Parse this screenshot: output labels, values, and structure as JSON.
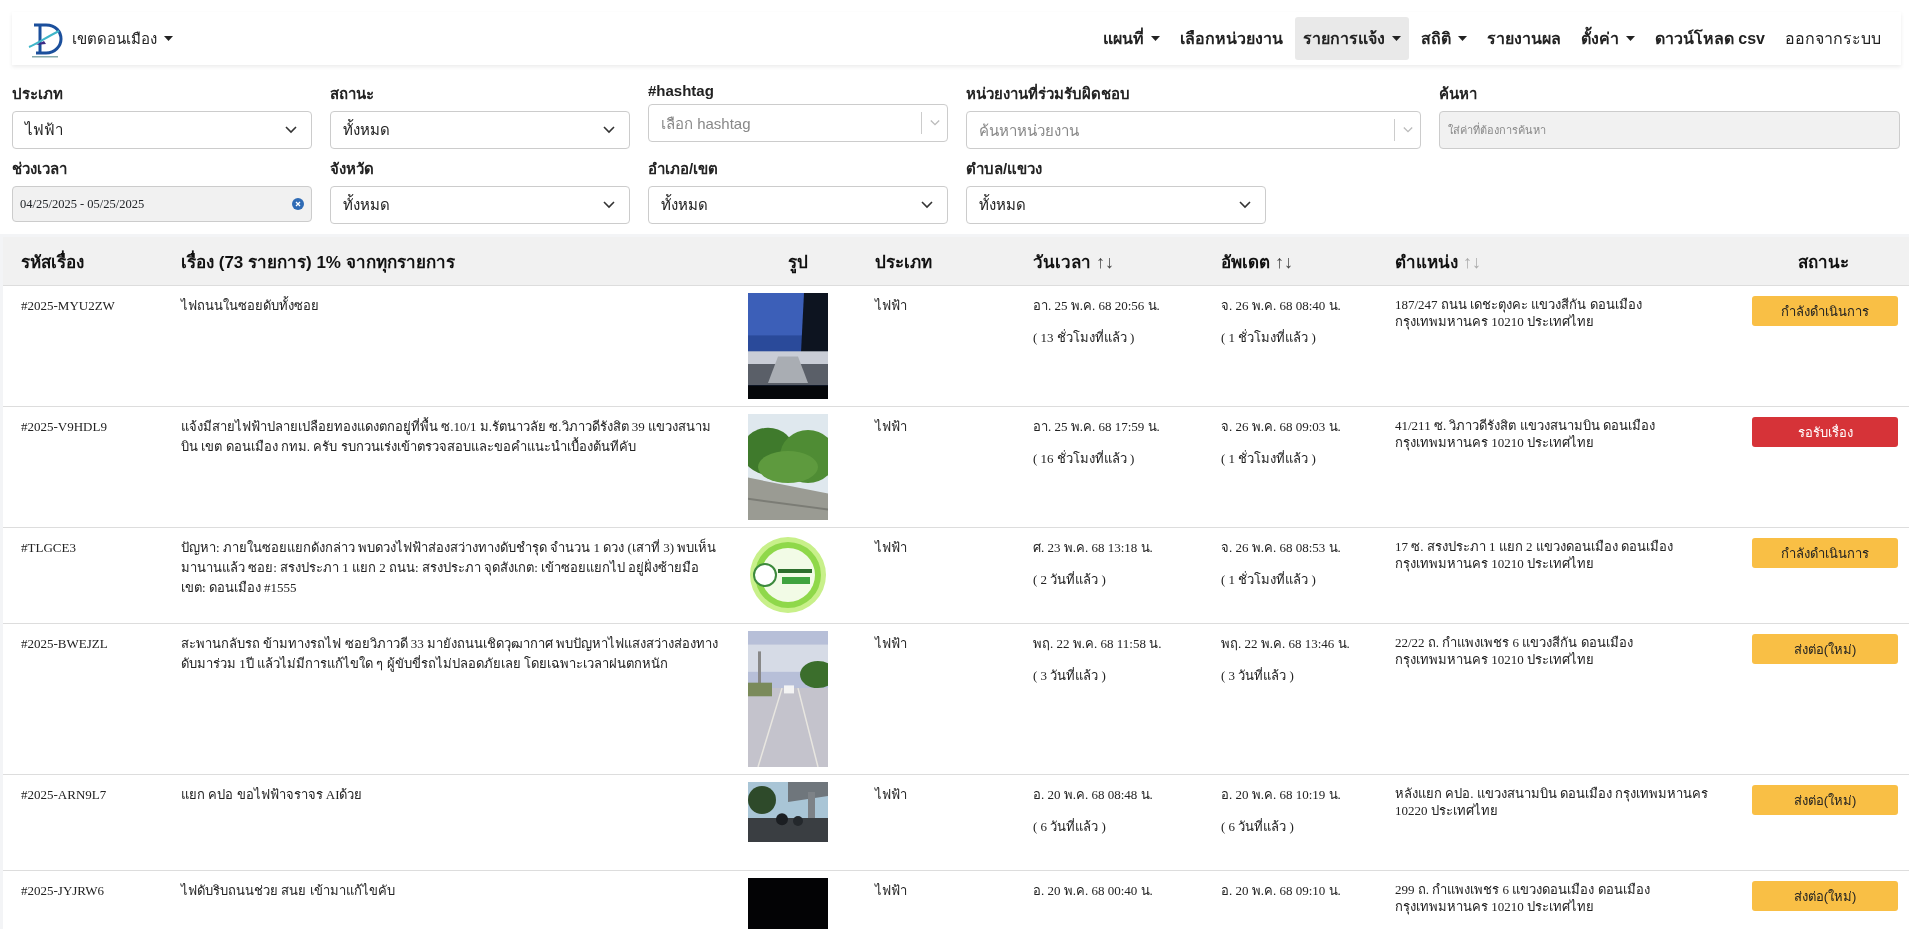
{
  "navbar": {
    "district": "เขตดอนเมือง",
    "menu": [
      {
        "label": "แผนที่",
        "dropdown": true,
        "selected": false,
        "bold": true
      },
      {
        "label": "เลือกหน่วยงาน",
        "dropdown": false,
        "selected": false,
        "bold": true
      },
      {
        "label": "รายการแจ้ง",
        "dropdown": true,
        "selected": true,
        "bold": true
      },
      {
        "label": "สถิติ",
        "dropdown": true,
        "selected": false,
        "bold": true
      },
      {
        "label": "รายงานผล",
        "dropdown": false,
        "selected": false,
        "bold": true
      },
      {
        "label": "ตั้งค่า",
        "dropdown": true,
        "selected": false,
        "bold": true
      },
      {
        "label": "ดาวน์โหลด csv",
        "dropdown": false,
        "selected": false,
        "bold": true
      },
      {
        "label": "ออกจากระบบ",
        "dropdown": false,
        "selected": false,
        "bold": false
      }
    ]
  },
  "filters": [
    {
      "label": "ประเภท",
      "kind": "select",
      "value": "ไฟฟ้า"
    },
    {
      "label": "สถานะ",
      "kind": "select",
      "value": "ทั้งหมด"
    },
    {
      "label": "#hashtag",
      "kind": "multiselect",
      "placeholder": "เลือก hashtag"
    },
    {
      "label": "หน่วยงานที่ร่วมรับผิดชอบ",
      "kind": "multiselect",
      "placeholder": "ค้นหาหน่วยงาน"
    },
    {
      "label": "ค้นหา",
      "kind": "search",
      "placeholder": "ใส่ค่าที่ต้องการค้นหา"
    },
    {
      "label": "ช่วงเวลา",
      "kind": "daterange",
      "value": "04/25/2025 - 05/25/2025"
    },
    {
      "label": "จังหวัด",
      "kind": "select",
      "value": "ทั้งหมด"
    },
    {
      "label": "อำเภอ/เขต",
      "kind": "select",
      "value": "ทั้งหมด"
    },
    {
      "label": "ตำบล/แขวง",
      "kind": "select",
      "value": "ทั้งหมด"
    }
  ],
  "table": {
    "columns": [
      {
        "label": "รหัสเรื่อง"
      },
      {
        "label": "เรื่อง (73 รายการ) 1% จากทุกรายการ"
      },
      {
        "label": "รูป"
      },
      {
        "label": "ประเภท"
      },
      {
        "label": "วันเวลา",
        "sort": "↑↓",
        "sorted": true
      },
      {
        "label": "อัพเดต",
        "sort": "↑↓",
        "sorted": true
      },
      {
        "label": "ตำแหน่ง",
        "sort": "↑↓",
        "sorted": false
      },
      {
        "label": "สถานะ"
      }
    ],
    "rows": [
      {
        "code": "#2025-MYU2ZW",
        "title": "ไฟถนนในซอยดับทั้งซอย",
        "type": "ไฟฟ้า",
        "created": "อา. 25 พ.ค. 68 20:56 น.",
        "created_ago": "( 13 ชั่วโมงที่แล้ว )",
        "updated": "จ. 26 พ.ค. 68 08:40 น.",
        "updated_ago": "( 1 ชั่วโมงที่แล้ว )",
        "location": "187/247 ถนน เดชะตุงคะ แขวงสีกัน ดอนเมือง กรุงเทพมหานคร 10210 ประเทศไทย",
        "status": {
          "label": "กำลังดำเนินการ",
          "color": "#f9bf45"
        }
      },
      {
        "code": "#2025-V9HDL9",
        "title": "แจ้งมีสายไฟฟ้าปลายเปลือยทองแดงตกอยู่ที่พื้น ซ.10/1 ม.รัตนาวลัย ซ.วิภาวดีรังสิต 39 แขวงสนามบิน เขต ดอนเมือง กทม. ครับ รบกวนเร่งเข้าตรวจสอบและขอคำแนะนำเบื้องต้นทีคับ",
        "type": "ไฟฟ้า",
        "created": "อา. 25 พ.ค. 68 17:59 น.",
        "created_ago": "( 16 ชั่วโมงที่แล้ว )",
        "updated": "จ. 26 พ.ค. 68 09:03 น.",
        "updated_ago": "( 1 ชั่วโมงที่แล้ว )",
        "location": "41/211 ซ. วิภาวดีรังสิต แขวงสนามบิน ดอนเมือง กรุงเทพมหานคร 10210 ประเทศไทย",
        "status": {
          "label": "รอรับเรื่อง",
          "color": "#d63338"
        }
      },
      {
        "code": "#TLGCE3",
        "title": "ปัญหา: ภายในซอยแยกดังกล่าว พบดวงไฟฟ้าส่องสว่างทางดับชำรุด จำนวน 1 ดวง (เสาที่ 3) พบเห็นมานานแล้ว ซอย: สรงประภา 1 แยก 2 ถนน: สรงประภา จุดสังเกต: เข้าซอยแยกไป อยู่ฝั่งซ้ายมือ เขต: ดอนเมือง #1555",
        "type": "ไฟฟ้า",
        "created": "ศ. 23 พ.ค. 68 13:18 น.",
        "created_ago": "( 2 วันที่แล้ว )",
        "updated": "จ. 26 พ.ค. 68 08:53 น.",
        "updated_ago": "( 1 ชั่วโมงที่แล้ว )",
        "location": "17 ซ. สรงประภา 1 แยก 2 แขวงดอนเมือง ดอนเมือง กรุงเทพมหานคร 10210 ประเทศไทย",
        "status": {
          "label": "กำลังดำเนินการ",
          "color": "#f9bf45"
        }
      },
      {
        "code": "#2025-BWEJZL",
        "title": "สะพานกลับรถ ข้ามทางรถไฟ ซอยวิภาวดี 33 มายังถนนเชิดวุฒากาศ พบปัญหาไฟแสงสว่างส่องทางดับมาร่วม 1ปี แล้วไม่มีการแก้ไขใด ๆ ผู้ขับขี่รถไม่ปลอดภัยเลย โดยเฉพาะเวลาฝนตกหนัก",
        "type": "ไฟฟ้า",
        "created": "พฤ. 22 พ.ค. 68 11:58 น.",
        "created_ago": "( 3 วันที่แล้ว )",
        "updated": "พฤ. 22 พ.ค. 68 13:46 น.",
        "updated_ago": "( 3 วันที่แล้ว )",
        "location": "22/22 ถ. กำแพงเพชร 6 แขวงสีกัน ดอนเมือง กรุงเทพมหานคร 10210 ประเทศไทย",
        "status": {
          "label": "ส่งต่อ(ใหม่)",
          "color": "#f9bf45"
        }
      },
      {
        "code": "#2025-ARN9L7",
        "title": "แยก คปอ ขอไฟฟ้าจราจร AIด้วย",
        "type": "ไฟฟ้า",
        "created": "อ. 20 พ.ค. 68 08:48 น.",
        "created_ago": "( 6 วันที่แล้ว )",
        "updated": "อ. 20 พ.ค. 68 10:19 น.",
        "updated_ago": "( 6 วันที่แล้ว )",
        "location": "หลังแยก คปอ. แขวงสนามบิน ดอนเมือง กรุงเทพมหานคร 10220 ประเทศไทย",
        "status": {
          "label": "ส่งต่อ(ใหม่)",
          "color": "#f9bf45"
        }
      },
      {
        "code": "#2025-JYJRW6",
        "title": "ไฟดับริบถนนช่วย สนย เข้ามาแก้ไขคับ",
        "type": "ไฟฟ้า",
        "created": "อ. 20 พ.ค. 68 00:40 น.",
        "updated": "อ. 20 พ.ค. 68 09:10 น.",
        "location": "299 ถ. กำแพงเพชร 6 แขวงดอนเมือง ดอนเมือง กรุงเทพมหานคร 10210 ประเทศไทย",
        "status": {
          "label": "ส่งต่อ(ใหม่)",
          "color": "#f9bf45"
        }
      }
    ]
  }
}
